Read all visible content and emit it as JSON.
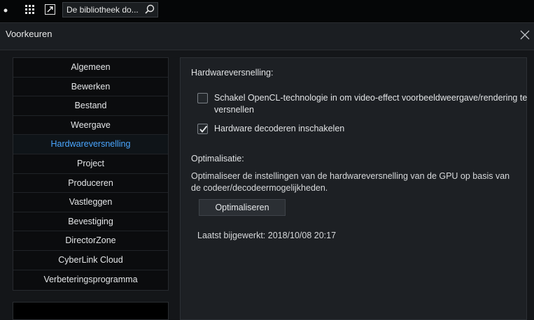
{
  "toolbar": {
    "search_text": "De bibliotheek do...",
    "icons": [
      "dot-icon",
      "grid-icon",
      "resize-icon",
      "search-icon"
    ]
  },
  "dialog": {
    "title": "Voorkeuren",
    "close_icon": "close-icon"
  },
  "sidebar": {
    "items": [
      {
        "label": "Algemeen",
        "active": false
      },
      {
        "label": "Bewerken",
        "active": false
      },
      {
        "label": "Bestand",
        "active": false
      },
      {
        "label": "Weergave",
        "active": false
      },
      {
        "label": "Hardwareversnelling",
        "active": true
      },
      {
        "label": "Project",
        "active": false
      },
      {
        "label": "Produceren",
        "active": false
      },
      {
        "label": "Vastleggen",
        "active": false
      },
      {
        "label": "Bevestiging",
        "active": false
      },
      {
        "label": "DirectorZone",
        "active": false
      },
      {
        "label": "CyberLink Cloud",
        "active": false
      },
      {
        "label": "Verbeteringsprogramma",
        "active": false
      }
    ]
  },
  "panel": {
    "section_hw": "Hardwareversnelling:",
    "opencl": {
      "label": "Schakel OpenCL-technologie in om video-effect voorbeeldweergave/rendering te versnellen",
      "checked": false
    },
    "hw_decode": {
      "label": "Hardware decoderen inschakelen",
      "checked": true
    },
    "section_opt": "Optimalisatie:",
    "opt_desc": "Optimaliseer de instellingen van de hardwareversnelling van de GPU op basis van de codeer/decodeermogelijkheden.",
    "opt_button": "Optimaliseren",
    "last_updated": "Laatst bijgewerkt: 2018/10/08 20:17"
  },
  "colors": {
    "accent": "#4aa6ff",
    "background": "#141619",
    "panel": "#1d2024"
  }
}
